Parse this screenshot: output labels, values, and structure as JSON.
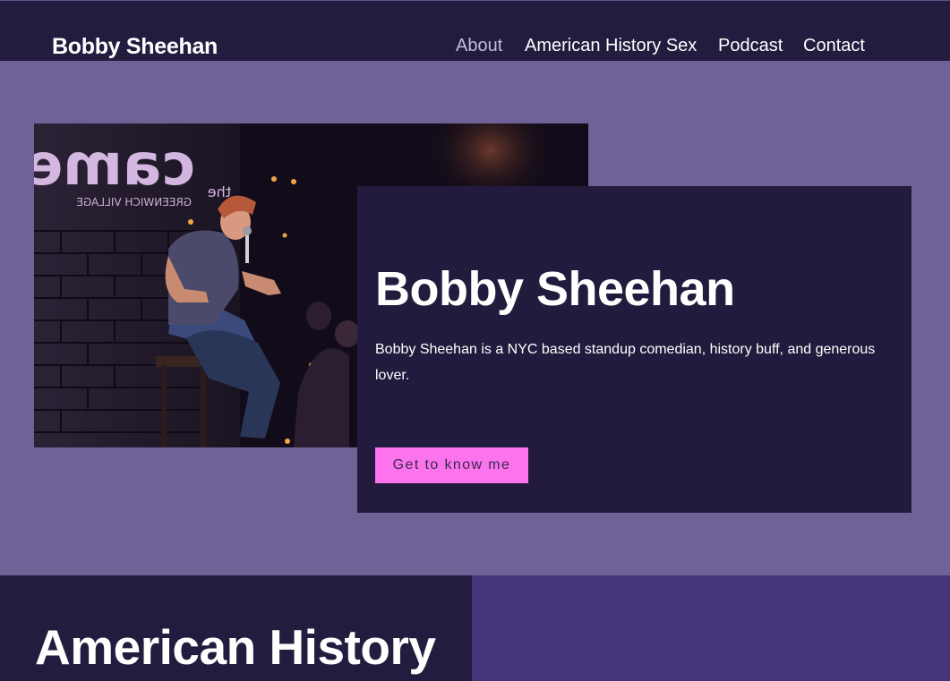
{
  "nav": {
    "brand": "Bobby Sheehan",
    "links": [
      {
        "label": "About",
        "active": true
      },
      {
        "label": "American History Sex",
        "active": false
      },
      {
        "label": "Podcast",
        "active": false
      },
      {
        "label": "Contact",
        "active": false
      }
    ]
  },
  "hero": {
    "photo": {
      "sign_text": "the cameo",
      "sign_subtext": "GREENWICH VILLAGE"
    },
    "title": "Bobby Sheehan",
    "description": "Bobby Sheehan is a NYC based standup comedian, history buff, and generous lover.",
    "cta_label": "Get to know me"
  },
  "section": {
    "title": "American History"
  },
  "colors": {
    "page_bg": "#6e6296",
    "nav_bg": "#231c3f",
    "card_bg": "#221b3e",
    "accent_pink": "#fb74ee",
    "section_right_bg": "#47357a"
  }
}
